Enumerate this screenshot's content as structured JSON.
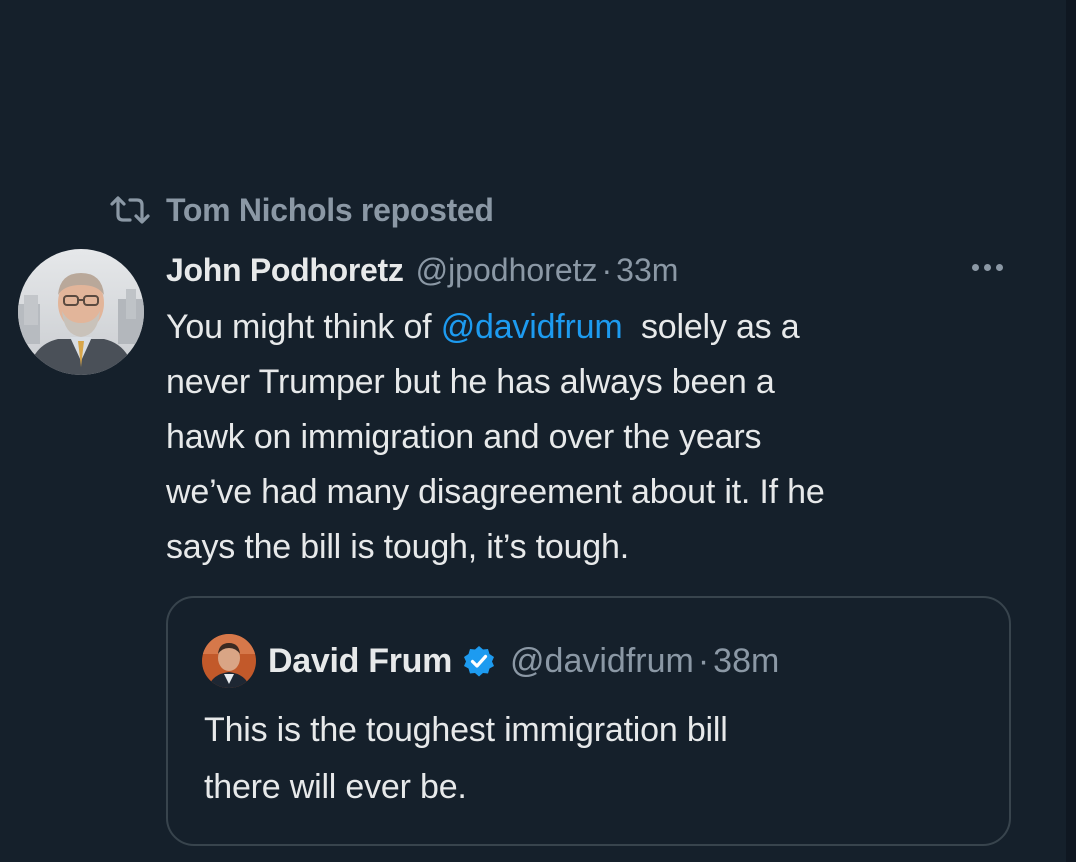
{
  "repost": {
    "label": "Tom Nichols reposted",
    "icon": "repost-icon"
  },
  "tweet": {
    "author_name": "John Podhoretz",
    "author_handle": "@jpodhoretz",
    "separator": "·",
    "time": "33m",
    "more_icon": "more-options-icon",
    "lines": [
      {
        "before": "You might think of ",
        "mention": "@davidfrum",
        "after": "  solely as a"
      },
      {
        "text": "never Trumper but he has always been a"
      },
      {
        "text": "hawk on immigration and over the years"
      },
      {
        "text": "we’ve had many disagreement about it. If he"
      },
      {
        "text": "says the bill is tough, it’s tough."
      }
    ]
  },
  "quote": {
    "author_name": "David Frum",
    "verified_icon": "verified-badge-icon",
    "author_handle": "@davidfrum",
    "separator": "·",
    "time": "38m",
    "lines": [
      "This is the toughest immigration bill",
      "there will ever be."
    ]
  },
  "colors": {
    "background": "#15202b",
    "text": "#e7e9ea",
    "secondary": "#8b98a5",
    "accent": "#1d9bf0",
    "border": "#38444d"
  }
}
